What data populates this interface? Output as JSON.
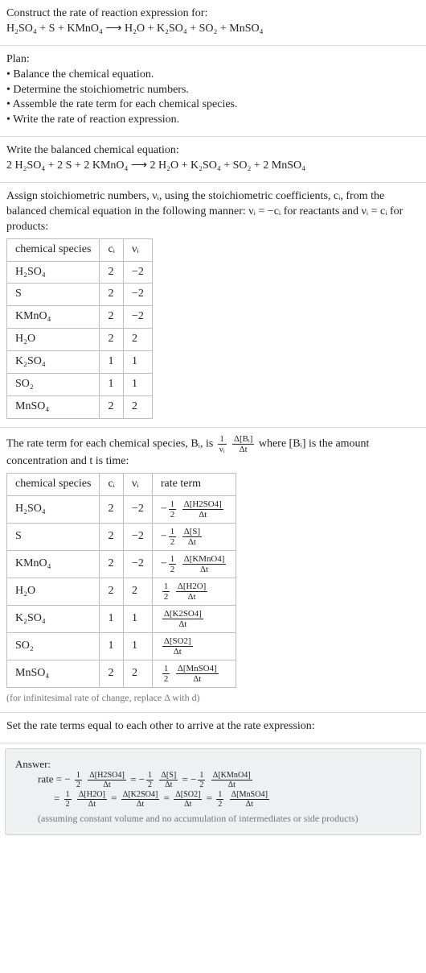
{
  "intro": {
    "line1_a": "Construct the rate of reaction expression for:",
    "line2": "H₂SO₄ + S + KMnO₄  ⟶  H₂O + K₂SO₄ + SO₂ + MnSO₄"
  },
  "plan": {
    "heading": "Plan:",
    "items": [
      "• Balance the chemical equation.",
      "• Determine the stoichiometric numbers.",
      "• Assemble the rate term for each chemical species.",
      "• Write the rate of reaction expression."
    ]
  },
  "balanced": {
    "heading": "Write the balanced chemical equation:",
    "eq": "2 H₂SO₄ + 2 S + 2 KMnO₄  ⟶  2 H₂O + K₂SO₄ + SO₂ + 2 MnSO₄"
  },
  "stoich_intro": "Assign stoichiometric numbers, νᵢ, using the stoichiometric coefficients, cᵢ, from the balanced chemical equation in the following manner: νᵢ = −cᵢ for reactants and νᵢ = cᵢ for products:",
  "table1": {
    "headers": [
      "chemical species",
      "cᵢ",
      "νᵢ"
    ],
    "rows": [
      [
        "H₂SO₄",
        "2",
        "−2"
      ],
      [
        "S",
        "2",
        "−2"
      ],
      [
        "KMnO₄",
        "2",
        "−2"
      ],
      [
        "H₂O",
        "2",
        "2"
      ],
      [
        "K₂SO₄",
        "1",
        "1"
      ],
      [
        "SO₂",
        "1",
        "1"
      ],
      [
        "MnSO₄",
        "2",
        "2"
      ]
    ]
  },
  "rateterm_intro_a": "The rate term for each chemical species, Bᵢ, is ",
  "rateterm_frac_pre": "1",
  "rateterm_frac_den": "νᵢ",
  "rateterm_frac2_n": "Δ[Bᵢ]",
  "rateterm_frac2_d": "Δt",
  "rateterm_intro_b": " where [Bᵢ] is the amount concentration and t is time:",
  "table2": {
    "headers": [
      "chemical species",
      "cᵢ",
      "νᵢ",
      "rate term"
    ],
    "rows": [
      {
        "sp": "H₂SO₄",
        "c": "2",
        "v": "−2",
        "neg": "−",
        "coef_n": "1",
        "coef_d": "2",
        "num": "Δ[H2SO4]",
        "den": "Δt"
      },
      {
        "sp": "S",
        "c": "2",
        "v": "−2",
        "neg": "−",
        "coef_n": "1",
        "coef_d": "2",
        "num": "Δ[S]",
        "den": "Δt"
      },
      {
        "sp": "KMnO₄",
        "c": "2",
        "v": "−2",
        "neg": "−",
        "coef_n": "1",
        "coef_d": "2",
        "num": "Δ[KMnO4]",
        "den": "Δt"
      },
      {
        "sp": "H₂O",
        "c": "2",
        "v": "2",
        "neg": "",
        "coef_n": "1",
        "coef_d": "2",
        "num": "Δ[H2O]",
        "den": "Δt"
      },
      {
        "sp": "K₂SO₄",
        "c": "1",
        "v": "1",
        "neg": "",
        "coef_n": "",
        "coef_d": "",
        "num": "Δ[K2SO4]",
        "den": "Δt"
      },
      {
        "sp": "SO₂",
        "c": "1",
        "v": "1",
        "neg": "",
        "coef_n": "",
        "coef_d": "",
        "num": "Δ[SO2]",
        "den": "Δt"
      },
      {
        "sp": "MnSO₄",
        "c": "2",
        "v": "2",
        "neg": "",
        "coef_n": "1",
        "coef_d": "2",
        "num": "Δ[MnSO4]",
        "den": "Δt"
      }
    ]
  },
  "inf_note": "(for infinitesimal rate of change, replace Δ with d)",
  "set_equal": "Set the rate terms equal to each other to arrive at the rate expression:",
  "answer": {
    "heading": "Answer:",
    "line1_prefix": "rate = −",
    "eq_terms1": [
      {
        "neg": "",
        "coef_n": "1",
        "coef_d": "2",
        "num": "Δ[H2SO4]",
        "den": "Δt",
        "tail": " = −"
      },
      {
        "neg": "",
        "coef_n": "1",
        "coef_d": "2",
        "num": "Δ[S]",
        "den": "Δt",
        "tail": " = −"
      },
      {
        "neg": "",
        "coef_n": "1",
        "coef_d": "2",
        "num": "Δ[KMnO4]",
        "den": "Δt",
        "tail": ""
      }
    ],
    "line2_prefix": "= ",
    "eq_terms2": [
      {
        "neg": "",
        "coef_n": "1",
        "coef_d": "2",
        "num": "Δ[H2O]",
        "den": "Δt",
        "tail": " = "
      },
      {
        "neg": "",
        "coef_n": "",
        "coef_d": "",
        "num": "Δ[K2SO4]",
        "den": "Δt",
        "tail": " = "
      },
      {
        "neg": "",
        "coef_n": "",
        "coef_d": "",
        "num": "Δ[SO2]",
        "den": "Δt",
        "tail": " = "
      },
      {
        "neg": "",
        "coef_n": "1",
        "coef_d": "2",
        "num": "Δ[MnSO4]",
        "den": "Δt",
        "tail": ""
      }
    ],
    "note": "(assuming constant volume and no accumulation of intermediates or side products)"
  },
  "chart_data": {
    "type": "table",
    "title": "Stoichiometric numbers and rate terms",
    "tables": [
      {
        "headers": [
          "chemical species",
          "c_i",
          "ν_i"
        ],
        "rows": [
          [
            "H2SO4",
            2,
            -2
          ],
          [
            "S",
            2,
            -2
          ],
          [
            "KMnO4",
            2,
            -2
          ],
          [
            "H2O",
            2,
            2
          ],
          [
            "K2SO4",
            1,
            1
          ],
          [
            "SO2",
            1,
            1
          ],
          [
            "MnSO4",
            2,
            2
          ]
        ]
      },
      {
        "headers": [
          "chemical species",
          "c_i",
          "ν_i",
          "rate term"
        ],
        "rows": [
          [
            "H2SO4",
            2,
            -2,
            "-(1/2) d[H2SO4]/dt"
          ],
          [
            "S",
            2,
            -2,
            "-(1/2) d[S]/dt"
          ],
          [
            "KMnO4",
            2,
            -2,
            "-(1/2) d[KMnO4]/dt"
          ],
          [
            "H2O",
            2,
            2,
            "(1/2) d[H2O]/dt"
          ],
          [
            "K2SO4",
            1,
            1,
            "d[K2SO4]/dt"
          ],
          [
            "SO2",
            1,
            1,
            "d[SO2]/dt"
          ],
          [
            "MnSO4",
            2,
            2,
            "(1/2) d[MnSO4]/dt"
          ]
        ]
      }
    ]
  }
}
